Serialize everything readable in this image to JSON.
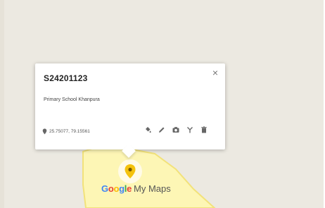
{
  "popup": {
    "title": "S24201123",
    "description": "Primary School Khanpura",
    "coordinates": "25.75077, 79.15561",
    "close_label": "×"
  },
  "actions": [
    {
      "name": "style",
      "icon": "paint-bucket-icon"
    },
    {
      "name": "edit",
      "icon": "pencil-icon"
    },
    {
      "name": "add-photo",
      "icon": "camera-icon"
    },
    {
      "name": "directions",
      "icon": "directions-fork-icon"
    },
    {
      "name": "delete",
      "icon": "trash-icon"
    }
  ],
  "branding": {
    "google": [
      "G",
      "o",
      "o",
      "g",
      "l",
      "e"
    ],
    "google_colors": [
      "#4285F4",
      "#EA4335",
      "#FBBC05",
      "#4285F4",
      "#34A853",
      "#EA4335"
    ],
    "product": "My Maps"
  },
  "colors": {
    "marker": "#f4c20d",
    "area_fill": "#fdf6b5",
    "area_border": "#f2e27a",
    "map_background": "#ece9e1"
  }
}
